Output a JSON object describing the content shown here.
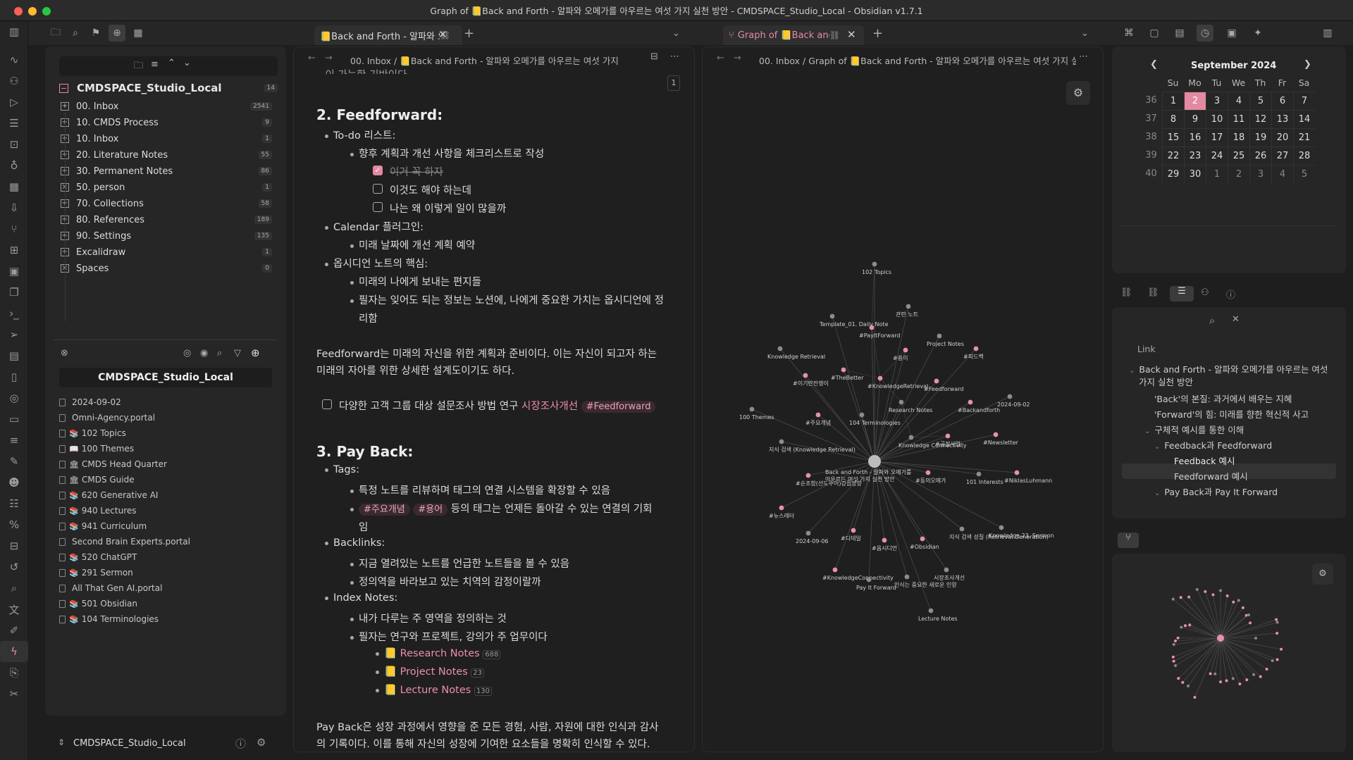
{
  "window": {
    "title": "Graph of 📒Back and Forth - 알파와 오메가를 아우르는 여섯 가지 실천 방안 - CMDSPACE_Studio_Local - Obsidian v1.7.1"
  },
  "tabs": {
    "left": {
      "title": "📒Back and Forth - 알파와 오메가를 아우르는 여섯 가지 실천 방안"
    },
    "right": {
      "title": "Graph of 📒Back and Forth"
    }
  },
  "breadcrumbs": {
    "left": {
      "folder": "00. Inbox",
      "sep": "/",
      "note": "📒Back and Forth - 알파와 오메가를 아우르는 여섯 가지 실천 방안"
    },
    "right": {
      "folder": "00. Inbox",
      "sep": "/",
      "note": "Graph of 📒Back and Forth - 알파와 오메가를 아우르는 여섯 가지 실천 방안"
    }
  },
  "explorer": {
    "vault": "CMDSPACE_Studio_Local",
    "vault_count": "14",
    "folders": [
      {
        "name": "00. Inbox",
        "count": "2541",
        "kind": "plus"
      },
      {
        "name": "10. CMDS Process",
        "count": "9",
        "kind": "plus"
      },
      {
        "name": "10. Inbox",
        "count": "1",
        "kind": "plus"
      },
      {
        "name": "20. Literature Notes",
        "count": "55",
        "kind": "plus"
      },
      {
        "name": "30. Permanent Notes",
        "count": "86",
        "kind": "plus"
      },
      {
        "name": "50. person",
        "count": "1",
        "kind": "x"
      },
      {
        "name": "70. Collections",
        "count": "58",
        "kind": "plus"
      },
      {
        "name": "80. References",
        "count": "189",
        "kind": "plus"
      },
      {
        "name": "90. Settings",
        "count": "135",
        "kind": "plus"
      },
      {
        "name": "Excalidraw",
        "count": "1",
        "kind": "plus"
      },
      {
        "name": "Spaces",
        "count": "0",
        "kind": "x"
      }
    ]
  },
  "spaces": {
    "header": "CMDSPACE_Studio_Local",
    "files": [
      {
        "emoji": "",
        "name": "2024-09-02"
      },
      {
        "emoji": "",
        "name": "Omni-Agency.portal"
      },
      {
        "emoji": "📚",
        "name": "102 Topics"
      },
      {
        "emoji": "📖",
        "name": "100 Themes"
      },
      {
        "emoji": "🏛",
        "name": "CMDS Head Quarter"
      },
      {
        "emoji": "🏛",
        "name": "CMDS Guide"
      },
      {
        "emoji": "📚",
        "name": "620 Generative AI"
      },
      {
        "emoji": "📚",
        "name": "940 Lectures"
      },
      {
        "emoji": "📚",
        "name": "941 Curriculum"
      },
      {
        "emoji": "",
        "name": "Second Brain Experts.portal"
      },
      {
        "emoji": "📚",
        "name": "520 ChatGPT"
      },
      {
        "emoji": "📚",
        "name": "291 Sermon"
      },
      {
        "emoji": "",
        "name": "All That Gen AI.portal"
      },
      {
        "emoji": "📚",
        "name": "501 Obsidian"
      },
      {
        "emoji": "📚",
        "name": "104 Terminologies"
      }
    ]
  },
  "footer": {
    "vault": "CMDSPACE_Studio_Local"
  },
  "editor": {
    "page_num": "1",
    "top_cut": "…이 가능한 기반이다.",
    "s2_heading": "2. Feedforward:",
    "todo_label": "To-do 리스트:",
    "todo_desc": "향후 계획과 개선 사항을 체크리스트로 작성",
    "todo1": "이거 꼭 하자",
    "todo2": "이것도 해야 하는데",
    "todo3": "나는 왜 이렇게 일이 많을까",
    "cal_label": "Calendar 플러그인:",
    "cal_desc": "미래 날짜에 개선 계획 예약",
    "core_label": "옵시디언 노트의 핵심:",
    "core1": "미래의 나에게 보내는 편지들",
    "core2a": "필자는 잊어도 되는 정보는 노션에, 나에게 중요한 가치는 옵시디언에 정",
    "core2b": "리함",
    "para1a": "Feedforward는 미래의 자신을 위한 계획과 준비이다. 이는 자신이 되고자 하는",
    "para1b": "미래의 자아를 위한 상세한 설계도이기도 하다.",
    "task_text": "다양한 고객 그룹 대상 설문조사 방법 연구",
    "task_link": "시장조사개선",
    "task_tag": "#Feedforward",
    "s3_heading": "3. Pay Back:",
    "tags_label": "Tags:",
    "tags1": "특정 노트를 리뷰하며 태그의 연결 시스템을 확장할 수 있음",
    "tag_a": "#주요개념",
    "tag_b": "#용어",
    "tags2a": "등의 태그는 언제든 돌아갈 수 있는 연결의 기회",
    "tags2b": "임",
    "back_label": "Backlinks:",
    "back1": "지금 열려있는 노트를 언급한 노트들을 볼 수 있음",
    "back2": "정의역을 바라보고 있는 치역의 감정이랄까",
    "index_label": "Index Notes:",
    "index1": "내가 다루는 주 영역을 정의하는 것",
    "index2": "필자는 연구와 프로젝트, 강의가 주 업무이다",
    "links": [
      {
        "name": "Research Notes",
        "count": "688"
      },
      {
        "name": "Project Notes",
        "count": "23"
      },
      {
        "name": "Lecture Notes",
        "count": "130"
      }
    ],
    "para2a": "Pay Back은 성장 과정에서 영향을 준 모든 경험, 사람, 자원에 대한 인식과 감사",
    "para2b": "의 기록이다. 이를 통해 자신의 성장에 기여한 요소들을 명확히 인식할 수 있다."
  },
  "graph": {
    "labels": [
      "102 Topics",
      "관련 노트",
      "Template_01. Daily Note",
      "#PayItForward",
      "Project Notes",
      "Knowledge Retrieval",
      "#용이",
      "#피드백",
      "#TheBetter",
      "#이기반전쟁이",
      "#KnowledgeRetrieval",
      "#Feedforward",
      "Research Notes",
      "2024-09-02",
      "100 Themes",
      "#주요개념",
      "104 Terminologies",
      "#Backandforth",
      "지식 검색 (Knowledge Retrieval)",
      "Knowledge Connectivity",
      "#공정사업",
      "#Newsletter",
      "Back and Forth - 알파와 오메가를",
      "아우르는 여섯 가지 실천 방안",
      "#순조함(선도주어)강점성향",
      "#뉴스레터",
      "101 Interests",
      "#NiklasLuhmann",
      "#동의오메가",
      "#디테일",
      "2024-09-06",
      "#Obsidian",
      "#옵시디언",
      "지식 검색 성질 (Retrieval Generation)",
      "Knowledge 23. Sermon",
      "시장조사개선",
      "#KnowledgeConnectivity",
      "Pay It Forward",
      "인식는 중요한 새로운 인양",
      "Lecture Notes"
    ]
  },
  "calendar": {
    "month": "September 2024",
    "weekdays": [
      "Su",
      "Mo",
      "Tu",
      "We",
      "Th",
      "Fr",
      "Sa"
    ],
    "weeks": [
      {
        "wk": "36",
        "days": [
          "1",
          "2",
          "3",
          "4",
          "5",
          "6",
          "7"
        ]
      },
      {
        "wk": "37",
        "days": [
          "8",
          "9",
          "10",
          "11",
          "12",
          "13",
          "14"
        ]
      },
      {
        "wk": "38",
        "days": [
          "15",
          "16",
          "17",
          "18",
          "19",
          "20",
          "21"
        ]
      },
      {
        "wk": "39",
        "days": [
          "22",
          "23",
          "24",
          "25",
          "26",
          "27",
          "28"
        ]
      },
      {
        "wk": "40",
        "days": [
          "29",
          "30",
          "1",
          "2",
          "3",
          "4",
          "5"
        ]
      }
    ],
    "today": "2"
  },
  "outline": {
    "header": "Link",
    "items": [
      {
        "text": "Back and Forth - 알파와 오메가를 아우르는 여섯",
        "lvl": 0,
        "arrow": "v"
      },
      {
        "text": "가지 실천 방안",
        "lvl": 0,
        "arrow": ""
      },
      {
        "text": "'Back'의 본질: 과거에서 배우는 지혜",
        "lvl": 1,
        "arrow": ""
      },
      {
        "text": "'Forward'의 힘: 미래를 향한 혁신적 사고",
        "lvl": 1,
        "arrow": ""
      },
      {
        "text": "구체적 예시를 통한 이해",
        "lvl": 1,
        "arrow": "v"
      },
      {
        "text": "Feedback과 Feedforward",
        "lvl": 2,
        "arrow": "v"
      },
      {
        "text": "Feedback 예시",
        "lvl": 3,
        "arrow": ""
      },
      {
        "text": "Feedforward 예시",
        "lvl": 3,
        "arrow": ""
      },
      {
        "text": "Pay Back과 Pay It Forward",
        "lvl": 2,
        "arrow": "v"
      }
    ]
  },
  "colors": {
    "accent": "#e28aa2",
    "bg": "#1e1e1e",
    "panel": "#262626"
  }
}
